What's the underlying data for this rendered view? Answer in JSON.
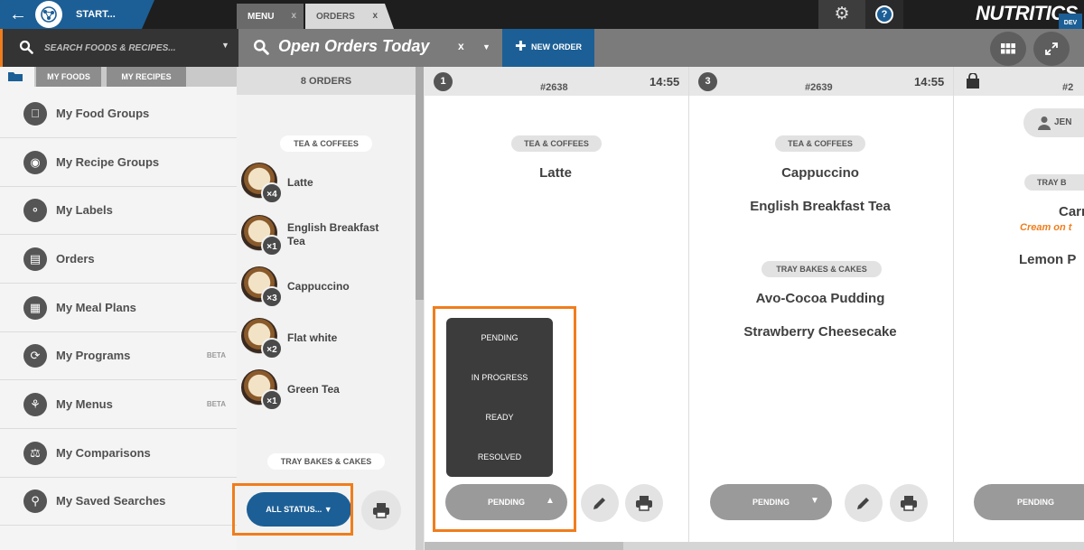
{
  "topbar": {
    "start_label": "START...",
    "tabs": [
      {
        "label": "MENU",
        "close": "x"
      },
      {
        "label": "ORDERS",
        "close": "x"
      }
    ],
    "brand": "NUTRITICS",
    "brand_badge": "DEV",
    "help_glyph": "?"
  },
  "search": {
    "placeholder": "SEARCH FOODS & RECIPES...",
    "title": "Open Orders Today",
    "clear": "x",
    "new_order_label": "NEW ORDER"
  },
  "sidebar": {
    "tabs": [
      "MY FOODS",
      "MY RECIPES"
    ],
    "items": [
      {
        "label": "My Food Groups",
        "icon": "apple-icon",
        "badge": ""
      },
      {
        "label": "My Recipe Groups",
        "icon": "chef-hat-icon",
        "badge": ""
      },
      {
        "label": "My Labels",
        "icon": "tag-icon",
        "badge": ""
      },
      {
        "label": "Orders",
        "icon": "document-icon",
        "badge": ""
      },
      {
        "label": "My Meal Plans",
        "icon": "clipboard-icon",
        "badge": ""
      },
      {
        "label": "My Programs",
        "icon": "cycle-icon",
        "badge": "BETA"
      },
      {
        "label": "My Menus",
        "icon": "cutlery-icon",
        "badge": "BETA"
      },
      {
        "label": "My Comparisons",
        "icon": "scales-icon",
        "badge": ""
      },
      {
        "label": "My Saved Searches",
        "icon": "search-icon",
        "badge": ""
      }
    ]
  },
  "summary": {
    "header": "8 ORDERS",
    "groups": [
      {
        "title": "TEA & COFFEES",
        "items": [
          {
            "name": "Latte",
            "qty": "×4"
          },
          {
            "name": "English Breakfast Tea",
            "qty": "×1"
          },
          {
            "name": "Cappuccino",
            "qty": "×3"
          },
          {
            "name": "Flat white",
            "qty": "×2"
          },
          {
            "name": "Green Tea",
            "qty": "×1"
          }
        ]
      },
      {
        "title": "TRAY BAKES & CAKES",
        "items": []
      }
    ],
    "status_button": "ALL STATUS... ▼"
  },
  "orders": [
    {
      "num": "1",
      "order_no": "#2638",
      "time": "14:55",
      "group1": "TEA & COFFEES",
      "dishes1": [
        "Latte"
      ],
      "group2": "",
      "dishes2": [],
      "status": "PENDING",
      "caret": "▲"
    },
    {
      "num": "3",
      "order_no": "#2639",
      "time": "14:55",
      "group1": "TEA & COFFEES",
      "dishes1": [
        "Cappuccino",
        "English Breakfast Tea"
      ],
      "group2": "TRAY BAKES & CAKES",
      "dishes2": [
        "Avo-Cocoa Pudding",
        "Strawberry Cheesecake"
      ],
      "status": "PENDING",
      "caret": "▼"
    },
    {
      "order_no": "#2",
      "customer": "JEN",
      "group": "TRAY B",
      "dish1": "Carr",
      "note": "Cream on t",
      "dish2": "Lemon P",
      "status": "PENDING"
    }
  ],
  "status_menu": [
    "PENDING",
    "IN PROGRESS",
    "READY",
    "RESOLVED"
  ],
  "colors": {
    "accent_blue": "#1c5f96",
    "highlight_orange": "#f07d1c",
    "note_orange": "#f07d1c"
  }
}
